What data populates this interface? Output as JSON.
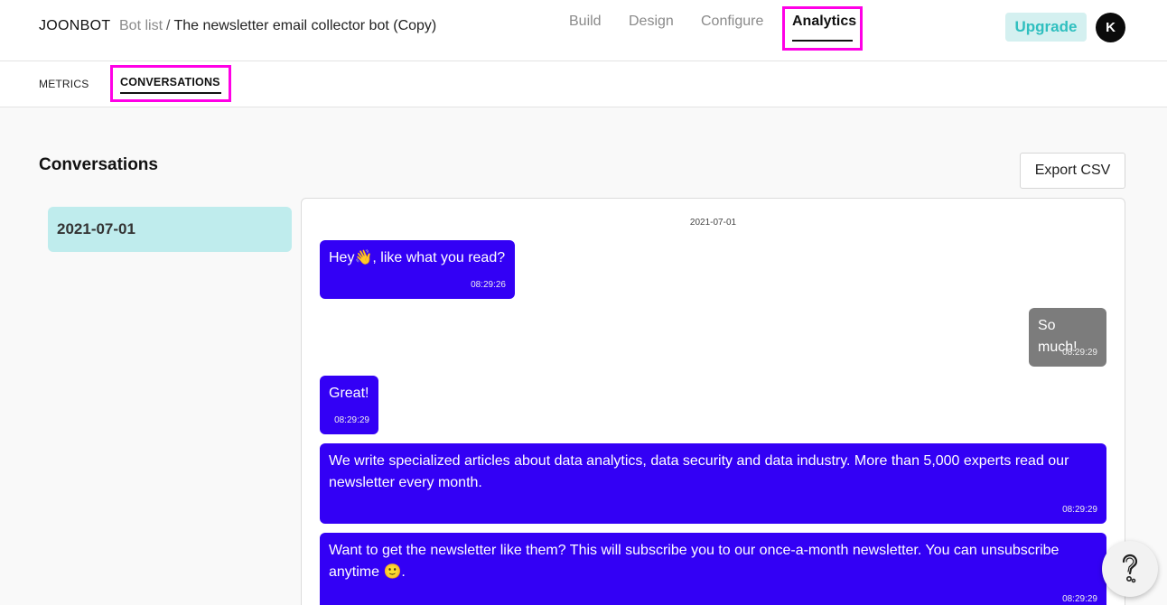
{
  "header": {
    "brand": "JOONBOT",
    "breadcrumb_botlist": "Bot list",
    "breadcrumb_separator": "/",
    "breadcrumb_current": "The newsletter email collector bot (Copy)",
    "nav": {
      "build": "Build",
      "design": "Design",
      "configure": "Configure",
      "analytics": "Analytics"
    },
    "active_nav": "Analytics",
    "upgrade_label": "Upgrade",
    "avatar_initial": "K"
  },
  "subnav": {
    "metrics": "METRICS",
    "conversations": "CONVERSATIONS",
    "active": "CONVERSATIONS"
  },
  "main": {
    "title": "Conversations",
    "export_label": "Export CSV",
    "dates": [
      "2021-07-01"
    ],
    "selected_date": "2021-07-01"
  },
  "chat": {
    "date": "2021-07-01",
    "messages": [
      {
        "from": "bot",
        "text": "Hey👋, like what you read?",
        "time": "08:29:26"
      },
      {
        "from": "user",
        "text": "So much!",
        "time": "08:29:29"
      },
      {
        "from": "bot",
        "text": "Great!",
        "time": "08:29:29"
      },
      {
        "from": "bot",
        "text": "We write specialized articles about data analytics, data security and data industry. More than 5,000 experts read our newsletter every month.",
        "time": "08:29:29"
      },
      {
        "from": "bot",
        "text": "Want to get the newsletter like them? This will subscribe you to our once-a-month newsletter. You can unsubscribe anytime 🙂.",
        "time": "08:29:29"
      }
    ]
  },
  "colors": {
    "accent_highlight": "#ff00e6",
    "bot_bubble": "#3300f5",
    "user_bubble": "#7c7c7c",
    "upgrade_bg": "#d4f0f0",
    "upgrade_text": "#2fbfbf",
    "date_selected_bg": "#bfeced"
  },
  "icons": {
    "help": "question-mark-icon"
  }
}
